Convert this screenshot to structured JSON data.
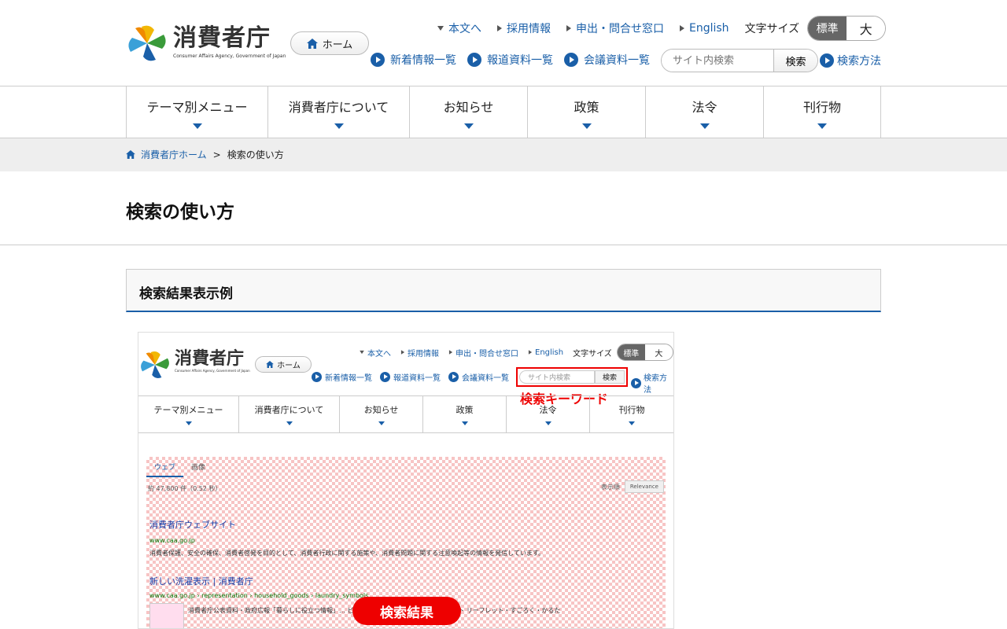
{
  "header": {
    "logo_jp": "消費者庁",
    "logo_en": "Consumer Affairs Agency, Government of Japan",
    "home_label": "ホーム",
    "top_links": [
      "本文へ",
      "採用情報",
      "申出・問合せ窓口",
      "English"
    ],
    "font_size_label": "文字サイズ",
    "font_size_options": [
      "標準",
      "大"
    ],
    "font_size_selected": "標準",
    "sub_links": [
      "新着情報一覧",
      "報道資料一覧",
      "会議資料一覧"
    ],
    "search_placeholder": "サイト内検索",
    "search_button": "検索",
    "search_help": "検索方法"
  },
  "nav": [
    "テーマ別メニュー",
    "消費者庁について",
    "お知らせ",
    "政策",
    "法令",
    "刊行物"
  ],
  "breadcrumb": {
    "home": "消費者庁ホーム",
    "sep": ">",
    "current": "検索の使い方"
  },
  "page_title": "検索の使い方",
  "section_title": "検索結果表示例",
  "example": {
    "logo_jp": "消費者庁",
    "logo_en": "Consumer Affairs Agency, Government of Japan",
    "home_label": "ホーム",
    "top_links": [
      "本文へ",
      "採用情報",
      "申出・問合せ窓口",
      "English"
    ],
    "font_size_label": "文字サイズ",
    "font_size_options": [
      "標準",
      "大"
    ],
    "sub_links": [
      "新着情報一覧",
      "報道資料一覧",
      "会議資料一覧"
    ],
    "search_placeholder": "サイト内検索",
    "search_button": "検索",
    "search_help": "検索方法",
    "keyword_label": "検索キーワード",
    "nav": [
      "テーマ別メニュー",
      "消費者庁について",
      "お知らせ",
      "政策",
      "法令",
      "刊行物"
    ],
    "tabs": [
      "ウェブ",
      "画像"
    ],
    "count": "約 47,800 件（0.52 秒）",
    "sort_label": "表示順",
    "sort_value": "Relevance",
    "results": [
      {
        "title": "消費者庁ウェブサイト",
        "url": "www.caa.go.jp",
        "desc": "消費者保護、安全の確保、消費者啓発を目的として、消費者行政に関する施策や、消費者問題に関する注意喚起等の情報を発信しています。"
      },
      {
        "title": "新しい洗濯表示 | 消費者庁",
        "url": "www.caa.go.jp › representation › household_goods › laundry_symbols",
        "desc": "消費者庁公表資料・政府広報「暮らしに役立つ情報」… ビ ポスター・リーフレット パンフレット リーフレット・すごろく・かるた"
      }
    ],
    "result_label": "検索結果"
  },
  "colors": {
    "accent": "#1a5fa8",
    "highlight": "#e00000"
  }
}
